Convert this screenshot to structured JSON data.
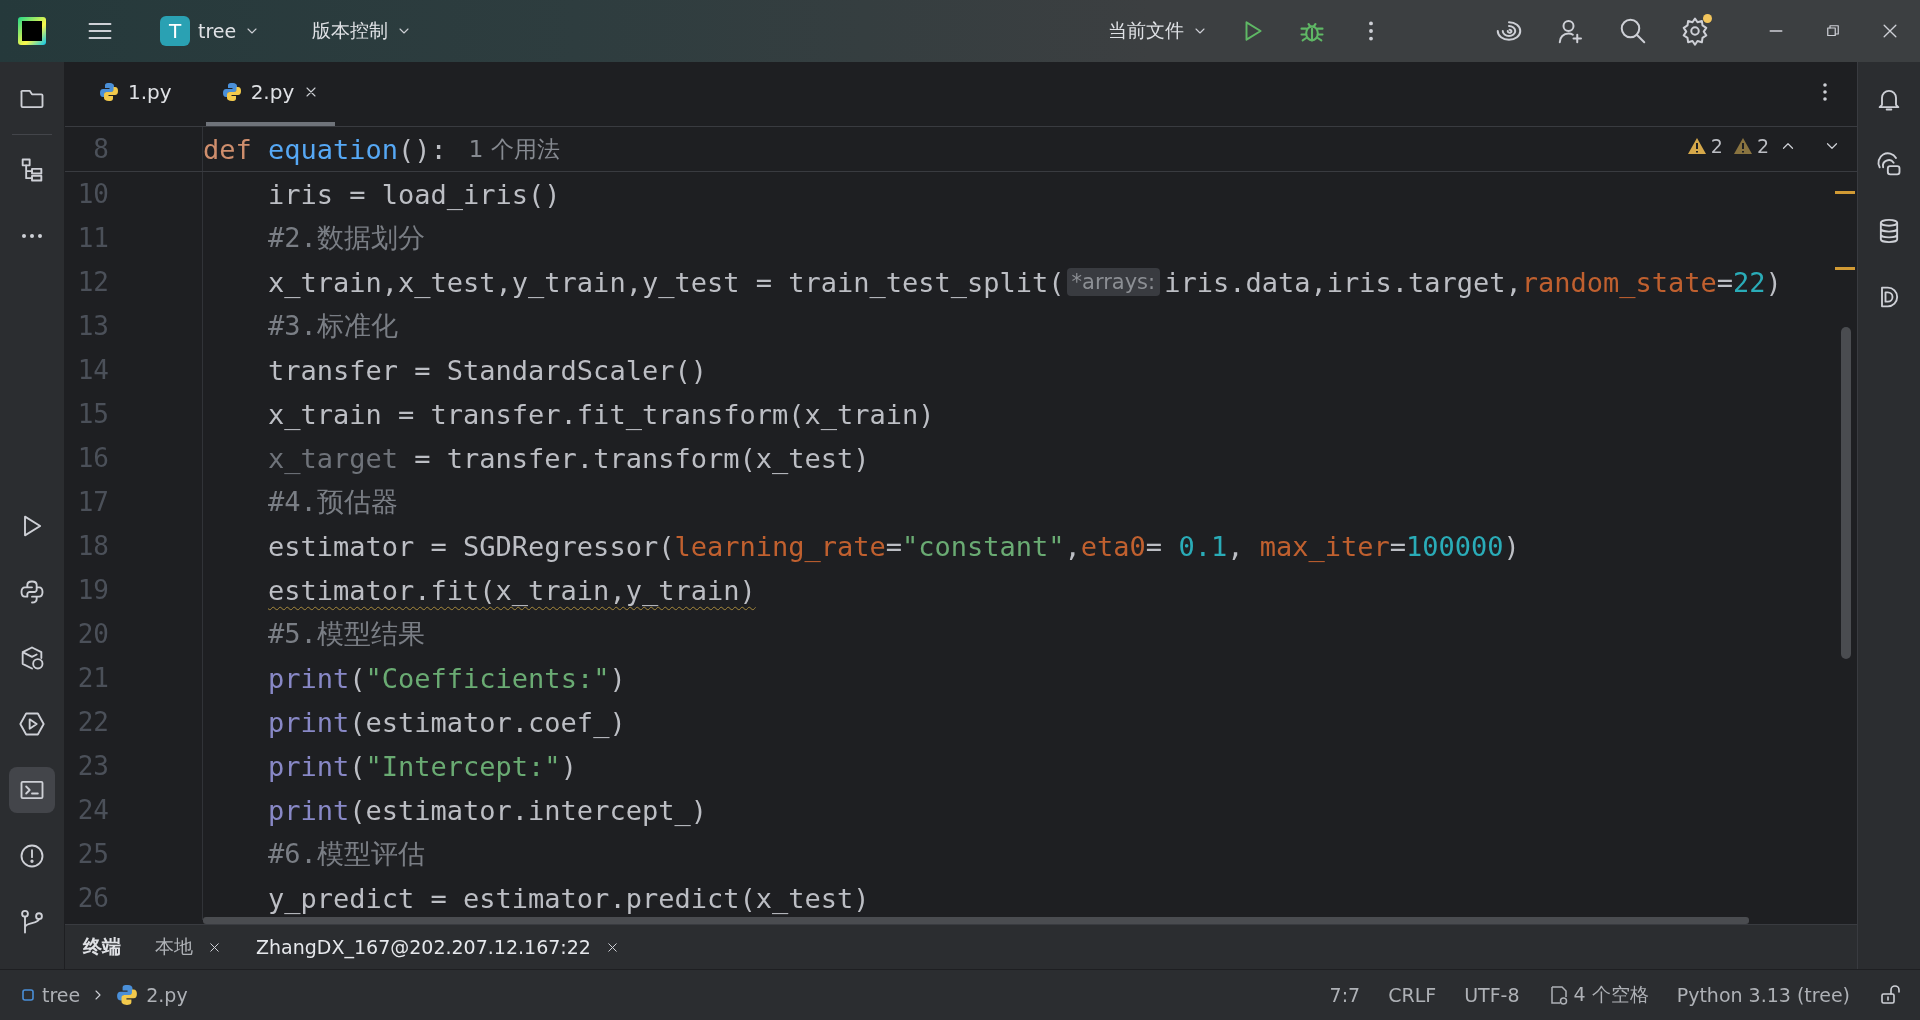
{
  "top_bar": {
    "project_badge": "T",
    "project_name": "tree",
    "vcs": "版本控制",
    "run_config": "当前文件",
    "settings_notice": true
  },
  "editor_tabs": [
    {
      "label": "1.py",
      "selected": false,
      "closable": false
    },
    {
      "label": "2.py",
      "selected": true,
      "closable": true
    }
  ],
  "inspections": [
    {
      "kind": "warning",
      "count": "2"
    },
    {
      "kind": "weak_warning",
      "count": "2"
    }
  ],
  "function": {
    "number": "8",
    "tokens": [
      {
        "kind": "kw",
        "text": "def "
      },
      {
        "kind": "fn",
        "text": "equation"
      },
      {
        "kind": "plain",
        "text": "():"
      },
      {
        "kind": "usages",
        "text": "1 个用法"
      }
    ],
    "body": [
      {
        "number": "10",
        "tokens": [
          {
            "kind": "plain",
            "text": "iris = load_iris()"
          }
        ]
      },
      {
        "number": "11",
        "tokens": [
          {
            "kind": "comment",
            "text": "#2.数据划分"
          }
        ]
      },
      {
        "number": "12",
        "tokens": [
          {
            "kind": "plain",
            "text": "x_train,x_test,y_train,y_test = train_test_split("
          },
          {
            "kind": "hint",
            "text": "*arrays:"
          },
          {
            "kind": "plain",
            "text": "iris.data,iris.target,"
          },
          {
            "kind": "param",
            "text": "random_state"
          },
          {
            "kind": "plain",
            "text": "="
          },
          {
            "kind": "number",
            "text": "22"
          },
          {
            "kind": "plain",
            "text": ")"
          }
        ]
      },
      {
        "number": "13",
        "tokens": [
          {
            "kind": "comment",
            "text": "#3.标准化"
          }
        ]
      },
      {
        "number": "14",
        "tokens": [
          {
            "kind": "plain",
            "text": "transfer = StandardScaler()"
          }
        ]
      },
      {
        "number": "15",
        "tokens": [
          {
            "kind": "plain",
            "text": "x_train = transfer.fit_transform(x_train)"
          }
        ]
      },
      {
        "number": "16",
        "tokens": [
          {
            "kind": "unused",
            "text": "x_target"
          },
          {
            "kind": "plain",
            "text": " = transfer.transform(x_test)"
          }
        ]
      },
      {
        "number": "17",
        "tokens": [
          {
            "kind": "comment",
            "text": "#4.预估器"
          }
        ]
      },
      {
        "number": "18",
        "tokens": [
          {
            "kind": "plain",
            "text": "estimator = SGDRegressor("
          },
          {
            "kind": "param",
            "text": "learning_rate"
          },
          {
            "kind": "plain",
            "text": "="
          },
          {
            "kind": "string",
            "text": "\"constant\""
          },
          {
            "kind": "plain",
            "text": ","
          },
          {
            "kind": "param",
            "text": "eta0"
          },
          {
            "kind": "plain",
            "text": "= "
          },
          {
            "kind": "number",
            "text": "0.1"
          },
          {
            "kind": "plain",
            "text": ", "
          },
          {
            "kind": "param",
            "text": "max_iter"
          },
          {
            "kind": "plain",
            "text": "="
          },
          {
            "kind": "number",
            "text": "100000"
          },
          {
            "kind": "plain",
            "text": ")"
          }
        ]
      },
      {
        "number": "19",
        "tokens": [
          {
            "kind": "warning",
            "text": "estimator.fit(x_train,y_train)"
          }
        ]
      },
      {
        "number": "20",
        "tokens": [
          {
            "kind": "comment",
            "text": "#5.模型结果"
          }
        ]
      },
      {
        "number": "21",
        "tokens": [
          {
            "kind": "builtin",
            "text": "print"
          },
          {
            "kind": "plain",
            "text": "("
          },
          {
            "kind": "string",
            "text": "\"Coefficients:\""
          },
          {
            "kind": "plain",
            "text": ")"
          }
        ]
      },
      {
        "number": "22",
        "tokens": [
          {
            "kind": "builtin",
            "text": "print"
          },
          {
            "kind": "plain",
            "text": "(estimator.coef_)"
          }
        ]
      },
      {
        "number": "23",
        "tokens": [
          {
            "kind": "builtin",
            "text": "print"
          },
          {
            "kind": "plain",
            "text": "("
          },
          {
            "kind": "string",
            "text": "\"Intercept:\""
          },
          {
            "kind": "plain",
            "text": ")"
          }
        ]
      },
      {
        "number": "24",
        "tokens": [
          {
            "kind": "builtin",
            "text": "print"
          },
          {
            "kind": "plain",
            "text": "(estimator.intercept_)"
          }
        ]
      },
      {
        "number": "25",
        "tokens": [
          {
            "kind": "comment",
            "text": "#6.模型评估"
          }
        ]
      },
      {
        "number": "26",
        "tokens": [
          {
            "kind": "plain",
            "text": "y_predict = estimator.predict(x_test)"
          }
        ]
      }
    ]
  },
  "left_tools_top": [
    {
      "kind": "folder",
      "selected": false
    },
    {
      "kind": "structure",
      "selected": false
    },
    {
      "kind": "more",
      "selected": false
    }
  ],
  "left_tools_bottom": [
    {
      "kind": "run",
      "selected": false
    },
    {
      "kind": "python",
      "selected": false
    },
    {
      "kind": "packages",
      "selected": false
    },
    {
      "kind": "services",
      "selected": false
    },
    {
      "kind": "terminal",
      "selected": true
    },
    {
      "kind": "problems",
      "selected": false
    },
    {
      "kind": "git",
      "selected": false
    }
  ],
  "right_tools": [
    {
      "kind": "bell"
    },
    {
      "kind": "chat"
    },
    {
      "kind": "database"
    },
    {
      "kind": "d"
    }
  ],
  "tool_window": {
    "title": "终端",
    "tabs": [
      {
        "label": "本地",
        "selected": false
      },
      {
        "label": "ZhangDX_167@202.207.12.167:22",
        "selected": true
      }
    ]
  },
  "status_bar": {
    "breadcrumbs": [
      {
        "kind": "project",
        "label": "tree"
      },
      {
        "kind": "python_file",
        "label": "2.py"
      }
    ],
    "items": [
      {
        "kind": "text",
        "label": "7:7"
      },
      {
        "kind": "text",
        "label": "CRLF"
      },
      {
        "kind": "text",
        "label": "UTF-8"
      },
      {
        "kind": "indent",
        "label": "4 个空格"
      },
      {
        "kind": "text",
        "label": "Python 3.13 (tree)"
      },
      {
        "kind": "lock"
      }
    ]
  }
}
